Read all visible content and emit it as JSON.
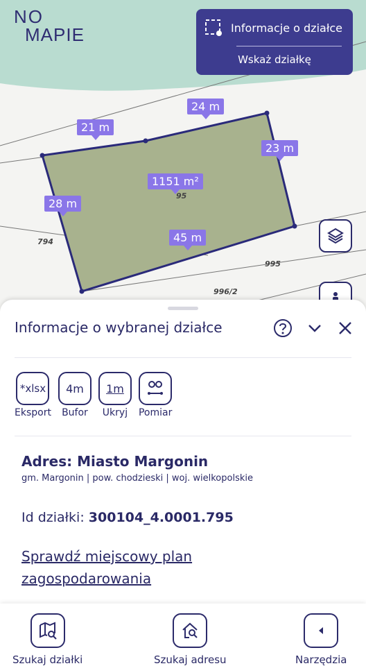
{
  "logo": {
    "line1": "NO",
    "line2": "MAPIE"
  },
  "info_box": {
    "title": "Informacje o działce",
    "action": "Wskaż działkę"
  },
  "map": {
    "segment_labels": [
      "24 m",
      "21 m",
      "23 m",
      "28 m",
      "45 m"
    ],
    "area_label": "1151 m²",
    "parcel_numbers": [
      "794",
      "995",
      "996/2",
      "95"
    ]
  },
  "sheet": {
    "title": "Informacje o wybranej działce",
    "tools": [
      {
        "icon": "*xlsx",
        "label": "Eksport"
      },
      {
        "icon": "4m",
        "label": "Bufor"
      },
      {
        "icon": "1m",
        "label": "Ukryj"
      },
      {
        "icon": "pin-measure",
        "label": "Pomiar"
      }
    ],
    "address_title": "Adres: Miasto Margonin",
    "address_sub": "gm. Margonin | pow. chodzieski | woj. wielkopolskie",
    "id_label": "Id działki: ",
    "id_value": "300104_4.0001.795",
    "plan_link": "Sprawdź miejscowy plan zagospodarowania"
  },
  "bottom_nav": [
    {
      "label": "Szukaj działki",
      "icon": "map-search-icon"
    },
    {
      "label": "Szukaj adresu",
      "icon": "home-search-icon"
    },
    {
      "label": "Narzędzia",
      "icon": "chevron-left-icon"
    }
  ],
  "colors": {
    "brand": "#3d3c8f",
    "label_bg": "#8a76e8",
    "parcel_fill": "#a8b28e",
    "water": "#b8dbd0"
  }
}
